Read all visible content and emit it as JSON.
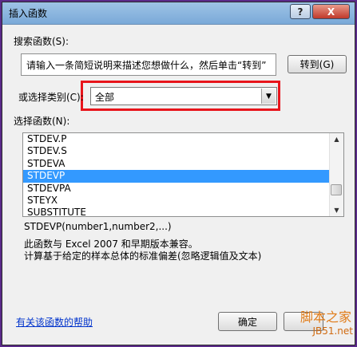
{
  "dialog": {
    "title": "插入函数",
    "help_btn": "?",
    "close_btn": "X"
  },
  "search": {
    "label": "搜索函数(S):",
    "value": "请输入一条简短说明来描述您想做什么，然后单击“转到”",
    "go_button": "转到(G)"
  },
  "category": {
    "label": "或选择类别(C):",
    "selected": "全部"
  },
  "functions": {
    "label": "选择函数(N):",
    "items": [
      "STDEV.P",
      "STDEV.S",
      "STDEVA",
      "STDEVP",
      "STDEVPA",
      "STEYX",
      "SUBSTITUTE"
    ],
    "selected_index": 3
  },
  "signature": "STDEVP(number1,number2,...)",
  "description_line1": "此函数与 Excel 2007 和早期版本兼容。",
  "description_line2": "计算基于给定的样本总体的标准偏差(忽略逻辑值及文本)",
  "help_link": "有关该函数的帮助",
  "ok_button": "确定",
  "watermark": {
    "line1": "脚本之家",
    "line2": "JB51.net"
  },
  "colors": {
    "highlight_box": "#e8141b",
    "selection": "#3399ff",
    "link": "#0033cc"
  }
}
